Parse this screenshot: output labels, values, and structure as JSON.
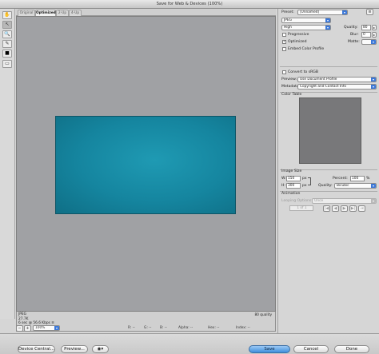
{
  "window": {
    "title": "Save for Web & Devices (100%)"
  },
  "tabs": [
    {
      "label": "Original"
    },
    {
      "label": "Optimized"
    },
    {
      "label": "2-Up"
    },
    {
      "label": "4-Up"
    }
  ],
  "tools": [
    {
      "icon": "hand-icon",
      "glyph": "✋"
    },
    {
      "icon": "slice-select-icon",
      "glyph": "↖"
    },
    {
      "icon": "zoom-icon",
      "glyph": "🔍"
    },
    {
      "icon": "eyedropper-icon",
      "glyph": "✎"
    },
    {
      "icon": "eyedropper-color-icon",
      "glyph": "■"
    },
    {
      "icon": "toggle-slices-icon",
      "glyph": "▭"
    }
  ],
  "info": {
    "format": "JPEG",
    "size": "27.7K",
    "download_time": "6 sec @ 56.6 Kbps",
    "menu_glyph": "≡",
    "quality_text": "80 quality"
  },
  "zoom": {
    "minus_glyph": "−",
    "plus_glyph": "+",
    "value": "100%",
    "readouts": [
      {
        "label": "R:",
        "value": "--"
      },
      {
        "label": "G:",
        "value": "--"
      },
      {
        "label": "B:",
        "value": "--"
      },
      {
        "label": "Alpha:",
        "value": "--"
      },
      {
        "label": "Hex:",
        "value": "--"
      },
      {
        "label": "Index:",
        "value": "--"
      }
    ]
  },
  "settings": {
    "preset_label": "Preset:",
    "preset_value": "[Unnamed]",
    "format_value": "JPEG",
    "compression_value": "High",
    "quality_label": "Quality:",
    "quality_value": "80",
    "progressive_label": "Progressive",
    "blur_label": "Blur:",
    "blur_value": "0",
    "optimized_label": "Optimized",
    "matte_label": "Matte:",
    "embed_profile_label": "Embed Color Profile",
    "convert_srgb_label": "Convert to sRGB",
    "preview_label": "Preview:",
    "preview_value": "Use Document Profile",
    "metadata_label": "Metadata:",
    "metadata_value": "Copyright and Contact Info"
  },
  "color_table": {
    "title": "Color Table"
  },
  "image_size": {
    "title": "Image Size",
    "w_label": "W:",
    "w_value": "150",
    "h_label": "H:",
    "h_value": "300",
    "unit": "px",
    "percent_label": "Percent:",
    "percent_value": "100",
    "percent_unit": "%",
    "quality_label": "Quality:",
    "quality_value": "Bicubic"
  },
  "animation": {
    "title": "Animation",
    "looping_label": "Looping Options:",
    "looping_value": "Once",
    "frame_counter": "1 of 1",
    "controls": [
      "|◀",
      "◀",
      "▶",
      "▶|",
      "⇥"
    ]
  },
  "buttons": {
    "device_central": "Device Central...",
    "preview": "Preview...",
    "save": "Save",
    "cancel": "Cancel",
    "done": "Done"
  },
  "colors": {
    "preview_fill": "#1a8fa9",
    "canvas_bg": "#a0a1a4",
    "save_button": "#3f8fdc"
  }
}
